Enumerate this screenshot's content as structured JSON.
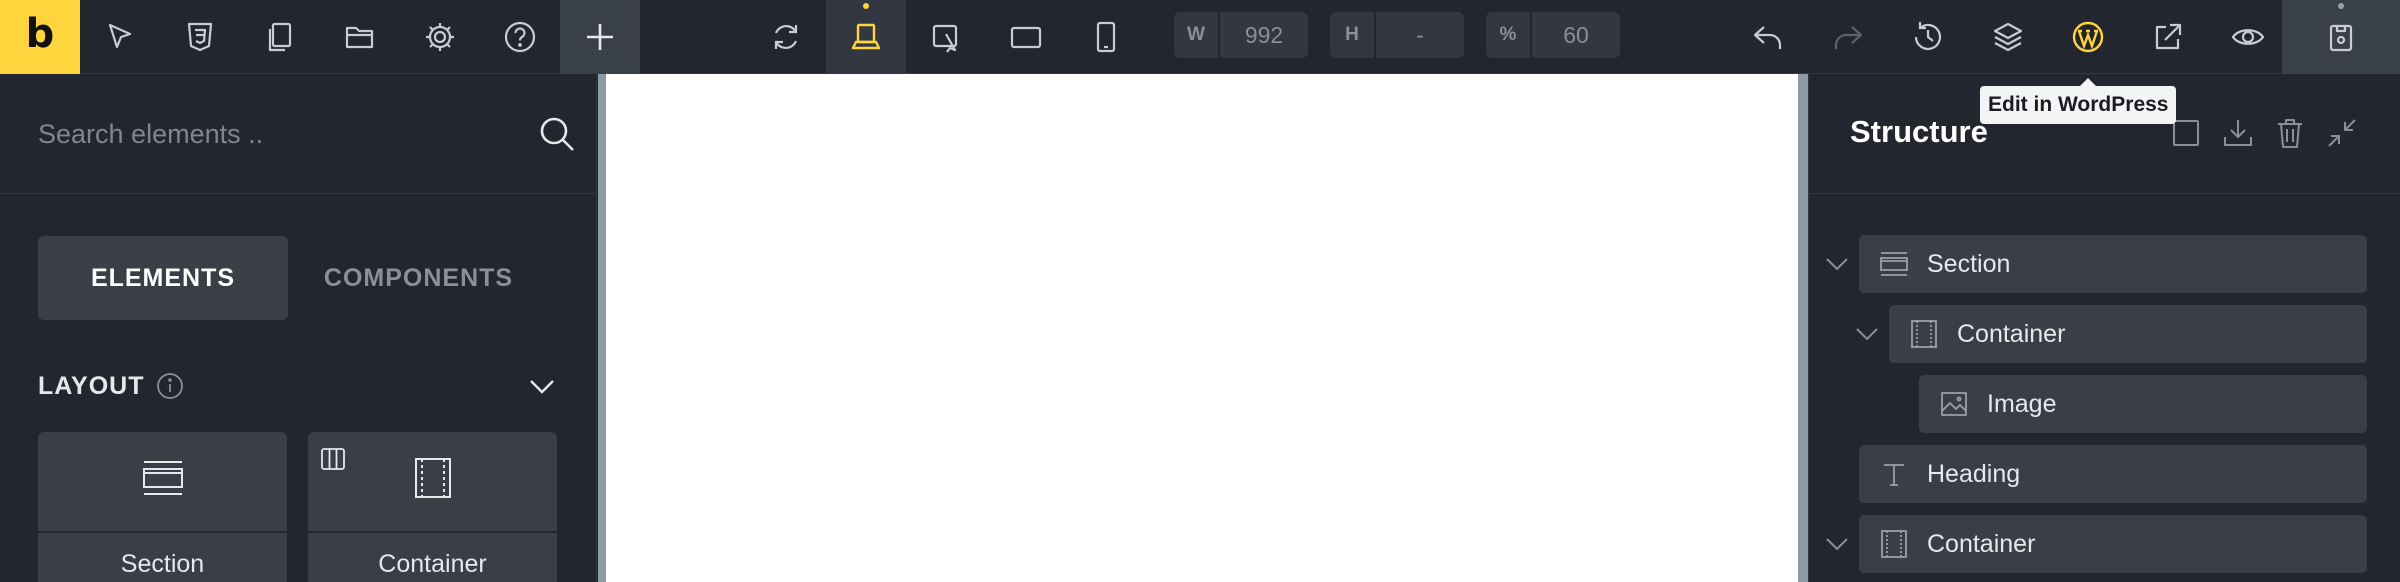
{
  "app": {
    "logo_letter": "b"
  },
  "toolbar": {
    "left_icons": [
      "cursor-icon",
      "css3-icon",
      "pages-icon",
      "folder-icon",
      "gear-icon",
      "help-icon",
      "plus-icon"
    ],
    "center_icons": [
      "refresh-icon",
      "desktop-breakpoint-icon",
      "laptop-breakpoint-icon",
      "tablet-landscape-icon",
      "mobile-icon"
    ],
    "width": {
      "label": "W",
      "value": "992"
    },
    "height": {
      "label": "H",
      "value": "-"
    },
    "scale": {
      "label": "%",
      "value": "60"
    },
    "right_icons": [
      "undo-icon",
      "redo-icon",
      "history-icon",
      "layers-icon",
      "wordpress-icon",
      "external-link-icon",
      "eye-icon",
      "save-icon"
    ],
    "accent": "#ffd53d"
  },
  "tooltip": {
    "text": "Edit in WordPress"
  },
  "left_panel": {
    "search": {
      "placeholder": "Search elements .."
    },
    "tabs": [
      {
        "label": "ELEMENTS",
        "selected": true
      },
      {
        "label": "COMPONENTS",
        "selected": false
      }
    ],
    "category": {
      "label": "LAYOUT"
    },
    "elements": [
      {
        "label": "Section",
        "icon": "section-icon"
      },
      {
        "label": "Container",
        "icon": "container-icon"
      }
    ]
  },
  "structure": {
    "title": "Structure",
    "header_icons": [
      "square-icon",
      "download-icon",
      "trash-icon",
      "collapse-icon"
    ],
    "nodes": [
      {
        "label": "Section",
        "icon": "section-icon",
        "depth": 0,
        "expanded": true
      },
      {
        "label": "Container",
        "icon": "container-icon",
        "depth": 1,
        "expanded": true
      },
      {
        "label": "Image",
        "icon": "image-icon",
        "depth": 2,
        "expanded": false
      },
      {
        "label": "Heading",
        "icon": "heading-icon",
        "depth": 0,
        "expanded": false
      },
      {
        "label": "Container",
        "icon": "container-icon",
        "depth": 0,
        "expanded": true
      }
    ]
  }
}
